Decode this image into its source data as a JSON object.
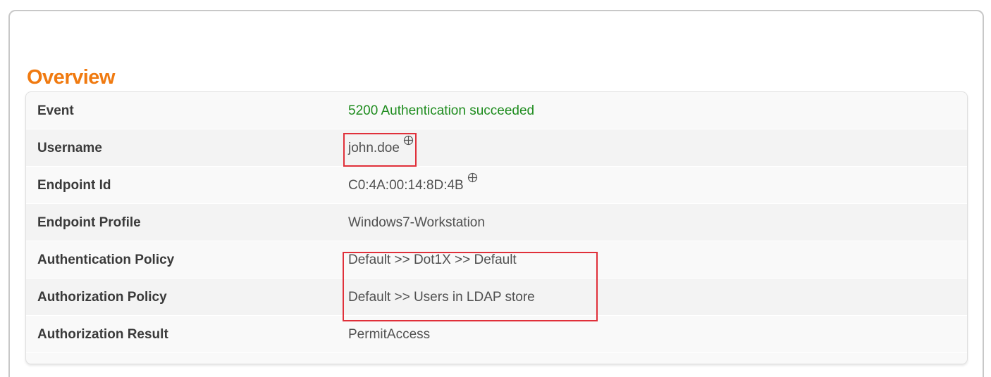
{
  "overview": {
    "title": "Overview",
    "rows": [
      {
        "label": "Event",
        "value": "5200 Authentication succeeded",
        "status": "success"
      },
      {
        "label": "Username",
        "value": "john.doe",
        "icon": "crosshair-icon"
      },
      {
        "label": "Endpoint Id",
        "value": "C0:4A:00:14:8D:4B",
        "icon": "crosshair-icon"
      },
      {
        "label": "Endpoint Profile",
        "value": "Windows7-Workstation"
      },
      {
        "label": "Authentication Policy",
        "value": "Default >> Dot1X >> Default"
      },
      {
        "label": "Authorization Policy",
        "value": "Default >> Users in LDAP store"
      },
      {
        "label": "Authorization Result",
        "value": "PermitAccess"
      }
    ]
  },
  "colors": {
    "title": "#f07a10",
    "success": "#1e8c1e",
    "highlight": "#e0303a",
    "label": "#3a3a3a",
    "value": "#505050"
  }
}
